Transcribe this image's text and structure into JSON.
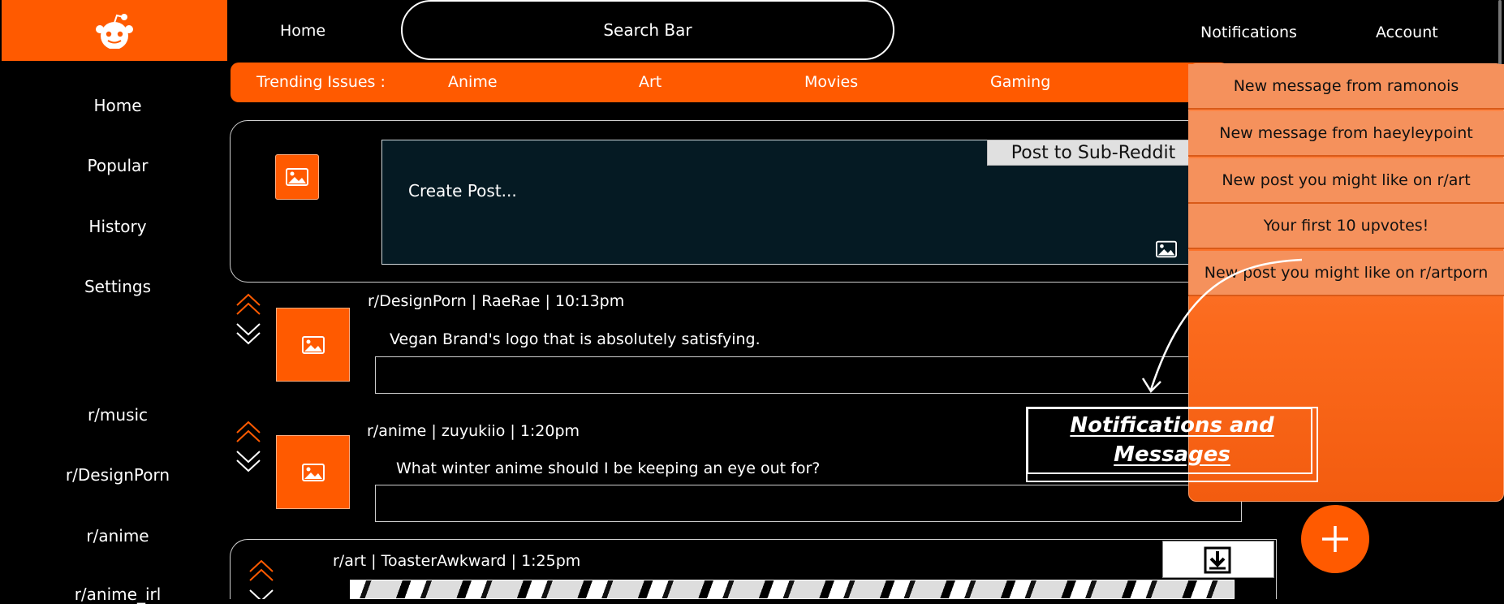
{
  "header": {
    "home": "Home",
    "search_placeholder": "Search Bar",
    "notifications": "Notifications",
    "account": "Account"
  },
  "trending": {
    "label": "Trending Issues :",
    "items": [
      "Anime",
      "Art",
      "Movies",
      "Gaming"
    ]
  },
  "sidebar": {
    "nav": [
      "Home",
      "Popular",
      "History",
      "Settings"
    ],
    "communities": [
      "r/music",
      "r/DesignPorn",
      "r/anime",
      "r/anime_irl"
    ]
  },
  "create_post": {
    "placeholder": "Create Post...",
    "post_button": "Post to Sub-Reddit"
  },
  "posts": [
    {
      "meta": "r/DesignPorn | RaeRae  | 10:13pm",
      "body": "Vegan Brand's logo that is absolutely satisfying."
    },
    {
      "meta": "r/anime | zuyukiio  | 1:20pm",
      "body": "What winter anime should I be keeping an eye out for?"
    },
    {
      "meta": "r/art | ToasterAwkward | 1:25pm",
      "body": ""
    }
  ],
  "notifications": [
    "New message from ramonois",
    "New message from haeyleypoint",
    "New post you might like on r/art",
    "Your first 10 upvotes!",
    "New post you might like on r/artporn"
  ],
  "annotation": {
    "line1": "Notifications and",
    "line2": "Messages"
  },
  "colors": {
    "accent": "#ff5a00",
    "panel_light": "#f5915c",
    "create_bg": "#051a23"
  }
}
